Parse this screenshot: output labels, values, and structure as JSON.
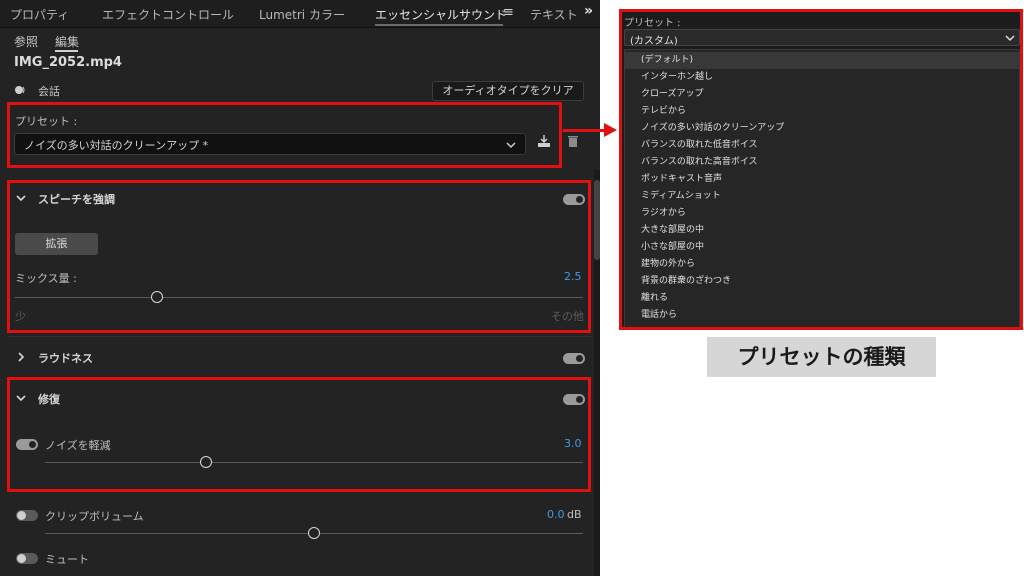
{
  "tabs": [
    "プロパティ",
    "エフェクトコントロール",
    "Lumetri カラー",
    "エッセンシャルサウンド",
    "テキスト"
  ],
  "subtabs": [
    "参照",
    "編集"
  ],
  "clip_name": "IMG_2052.mp4",
  "audio_type": "会話",
  "clear_button": "オーディオタイプをクリア",
  "preset": {
    "label": "プリセット :",
    "value": "ノイズの多い対話のクリーンアップ *"
  },
  "speech": {
    "title": "スピーチを強調",
    "enhance_button": "拡張",
    "mix_label": "ミックス量 :",
    "mix_value": "2.5",
    "mix_fraction": 0.25,
    "range_min": "少",
    "range_max": "その他"
  },
  "loudness": {
    "title": "ラウドネス"
  },
  "repair": {
    "title": "修復",
    "noise_label": "ノイズを軽減",
    "noise_value": "3.0",
    "noise_fraction": 0.3
  },
  "clip_volume": {
    "label": "クリップボリューム",
    "value": "0.0",
    "unit": "dB"
  },
  "mute": {
    "label": "ミュート"
  },
  "dropdown": {
    "label": "プリセット :",
    "selected": "(カスタム)",
    "items": [
      "(デフォルト)",
      "インターホン越し",
      "クローズアップ",
      "テレビから",
      "ノイズの多い対話のクリーンアップ",
      "バランスの取れた低音ボイス",
      "バランスの取れた高音ボイス",
      "ポッドキャスト音声",
      "ミディアムショット",
      "ラジオから",
      "大きな部屋の中",
      "小さな部屋の中",
      "建物の外から",
      "背景の群衆のざわつき",
      "離れる",
      "電話から"
    ]
  },
  "caption": "プリセットの種類",
  "colors": {
    "highlight": "#e01010",
    "value_blue": "#3e9bde",
    "panel_bg": "#232323"
  }
}
